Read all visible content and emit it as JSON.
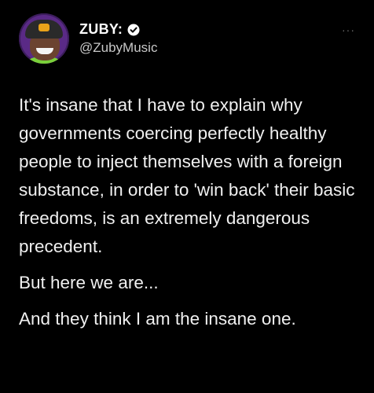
{
  "tweet": {
    "display_name": "ZUBY:",
    "handle": "@ZubyMusic",
    "more_label": "···",
    "paragraphs": [
      "It's insane that I have to explain why governments coercing perfectly healthy people to inject themselves with a foreign substance, in order to 'win back' their basic freedoms, is an extremely dangerous precedent.",
      "But here we are...",
      "And they think I am the insane one."
    ]
  },
  "icons": {
    "verified": "verified-badge-icon",
    "more": "more-options-icon"
  },
  "colors": {
    "background": "#000000",
    "text": "#f0f0f0",
    "handle": "#c8c8c8",
    "avatar_bg": "#5a2a86"
  }
}
